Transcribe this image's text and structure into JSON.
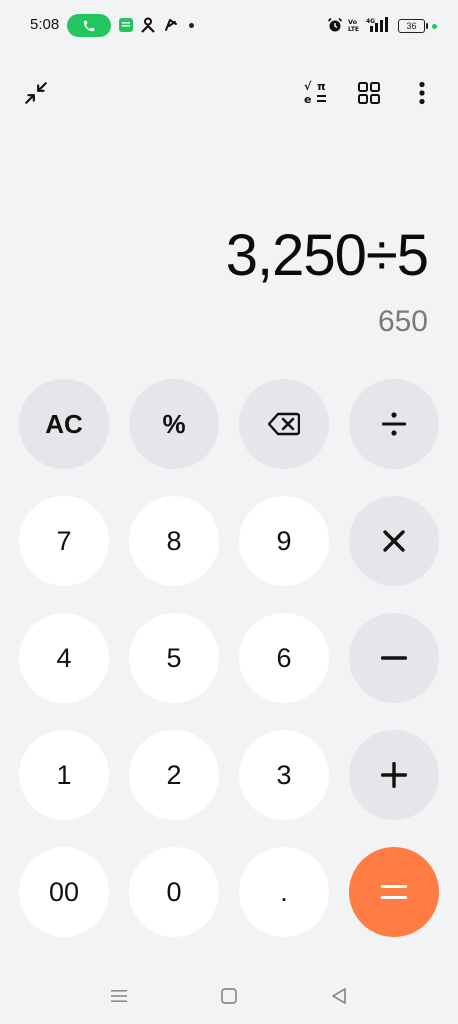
{
  "status_bar": {
    "time": "5:08",
    "battery": "36",
    "network_label": "VoLTE",
    "signal_label": "4G"
  },
  "toolbar": {
    "collapse_icon": "collapse-icon",
    "scientific_icon": "scientific-mode-icon",
    "grid_icon": "grid-icon",
    "more_icon": "more-vertical-icon"
  },
  "display": {
    "expression": "3,250÷5",
    "result": "650"
  },
  "keypad": {
    "ac": "AC",
    "percent": "%",
    "backspace_icon": "backspace-icon",
    "divide": "÷",
    "seven": "7",
    "eight": "8",
    "nine": "9",
    "multiply": "×",
    "four": "4",
    "five": "5",
    "six": "6",
    "minus": "−",
    "one": "1",
    "two": "2",
    "three": "3",
    "plus": "+",
    "double_zero": "00",
    "zero": "0",
    "decimal": ".",
    "equals": "="
  },
  "colors": {
    "background": "#f1f3f5",
    "number_key": "#ffffff",
    "function_key": "#e4e6e9",
    "equals_key": "#ff7c45",
    "call_pill": "#22c55e"
  },
  "nav_bar": {
    "menu_icon": "menu-icon",
    "home_icon": "home-icon",
    "back_icon": "back-icon"
  }
}
